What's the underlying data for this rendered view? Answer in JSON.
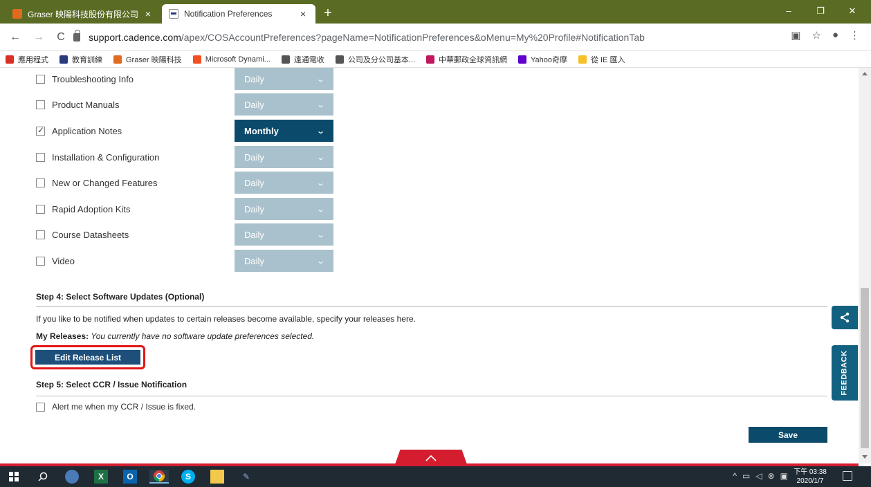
{
  "browser": {
    "tabs": [
      {
        "title": "Graser 映陽科技股份有限公司",
        "active": false
      },
      {
        "title": "Notification Preferences",
        "active": true
      }
    ],
    "new_tab": "+",
    "window_controls": {
      "minimize": "–",
      "restore": "❐",
      "close": "✕"
    },
    "nav": {
      "back": "←",
      "forward": "→",
      "reload": "C"
    },
    "url_host": "support.cadence.com",
    "url_path": "/apex/COSAccountPreferences?pageName=NotificationPreferences&oMenu=My%20Profile#NotificationTab",
    "bookmarks": [
      {
        "label": "應用程式",
        "color": "#d93025"
      },
      {
        "label": "教育訓練",
        "color": "#2a3a7a"
      },
      {
        "label": "Graser 映陽科技",
        "color": "#e06b1f"
      },
      {
        "label": "Microsoft Dynami...",
        "color": "#f25022"
      },
      {
        "label": "遠通電收",
        "color": "#555555"
      },
      {
        "label": "公司及分公司基本...",
        "color": "#555555"
      },
      {
        "label": "中華郵政全球資訊網",
        "color": "#c2185b"
      },
      {
        "label": "Yahoo奇摩",
        "color": "#6001d2"
      },
      {
        "label": "從 IE 匯入",
        "color": "#f6c026"
      }
    ]
  },
  "notifications": {
    "rows": [
      {
        "label": "Troubleshooting Info",
        "checked": false,
        "frequency": "Daily"
      },
      {
        "label": "Product Manuals",
        "checked": false,
        "frequency": "Daily"
      },
      {
        "label": "Application Notes",
        "checked": true,
        "frequency": "Monthly"
      },
      {
        "label": "Installation & Configuration",
        "checked": false,
        "frequency": "Daily"
      },
      {
        "label": "New or Changed Features",
        "checked": false,
        "frequency": "Daily"
      },
      {
        "label": "Rapid Adoption Kits",
        "checked": false,
        "frequency": "Daily"
      },
      {
        "label": "Course Datasheets",
        "checked": false,
        "frequency": "Daily"
      },
      {
        "label": "Video",
        "checked": false,
        "frequency": "Daily"
      }
    ]
  },
  "step4": {
    "title": "Step 4: Select Software Updates (Optional)",
    "description": "If you like to be notified when updates to certain releases become available, specify your releases here.",
    "my_releases_label": "My Releases:",
    "my_releases_value": "You currently have no software update preferences selected.",
    "edit_button": "Edit Release List"
  },
  "step5": {
    "title": "Step 5: Select CCR / Issue Notification",
    "alert_label": "Alert me when my CCR / Issue is fixed."
  },
  "save_label": "Save",
  "feedback_label": "FEEDBACK",
  "colors": {
    "primary": "#0b4a6b",
    "disabled_select": "#a9c1cc",
    "highlight": "#e31515",
    "accent_red": "#d41e2f"
  },
  "taskbar": {
    "clock_time": "下午 03:38",
    "clock_date": "2020/1/7"
  }
}
